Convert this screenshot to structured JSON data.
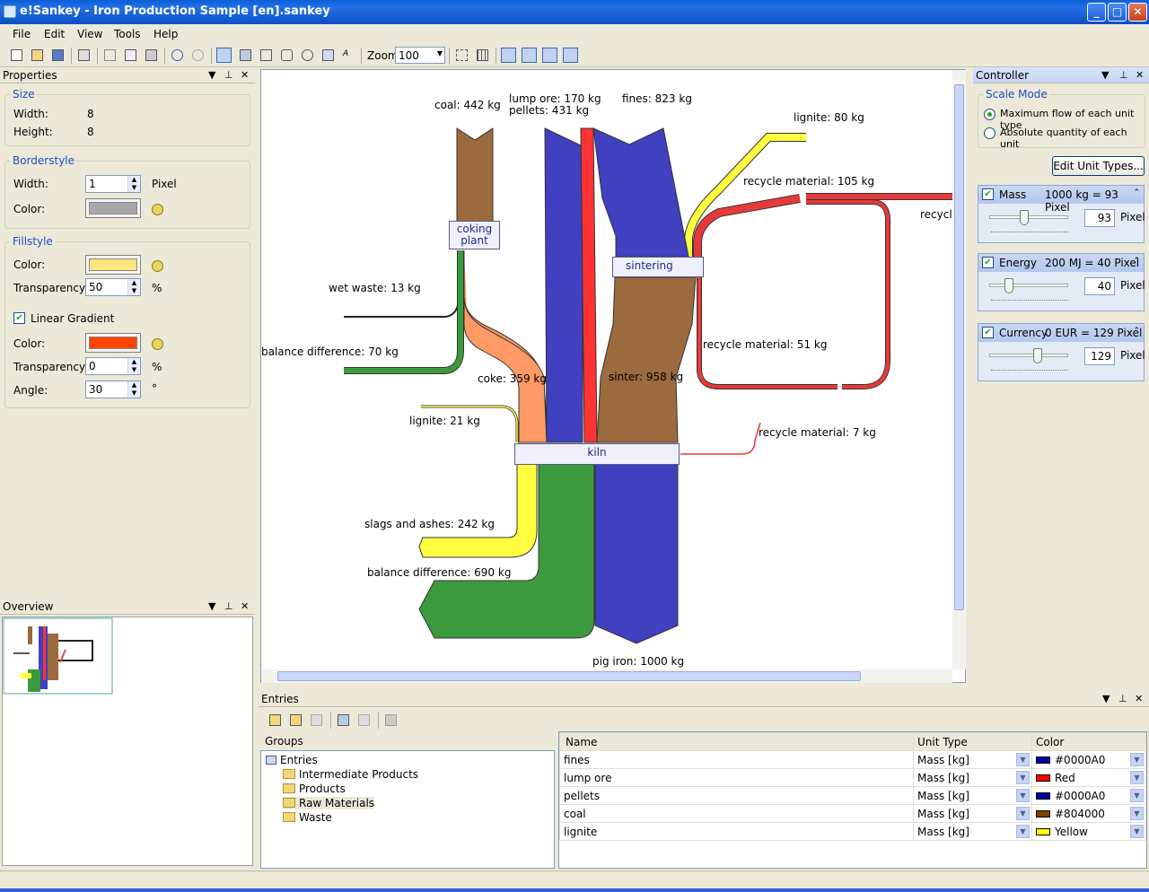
{
  "window": {
    "title": "e!Sankey - Iron Production Sample [en].sankey",
    "min": "_",
    "max": "□",
    "close": "✕"
  },
  "menu": [
    "File",
    "Edit",
    "View",
    "Tools",
    "Help"
  ],
  "toolbar": {
    "zoom_label": "Zoom",
    "zoom_value": "100"
  },
  "properties": {
    "title": "Properties",
    "size": {
      "label": "Size",
      "width_label": "Width:",
      "width": "8",
      "height_label": "Height:",
      "height": "8"
    },
    "borderstyle": {
      "label": "Borderstyle",
      "width_label": "Width:",
      "width": "1",
      "unit": "Pixel",
      "color_label": "Color:",
      "color": "#a8a8a8"
    },
    "fillstyle": {
      "label": "Fillstyle",
      "color_label": "Color:",
      "color": "#ffe680",
      "transparency_label": "Transparency:",
      "transparency": "50",
      "pct": "%",
      "gradient_label": "Linear Gradient",
      "gcolor_label": "Color:",
      "gcolor": "#ff4400",
      "gtrans_label": "Transparency:",
      "gtrans": "0",
      "gpct": "%",
      "angle_label": "Angle:",
      "angle": "30",
      "deg": "°"
    }
  },
  "overview": {
    "title": "Overview"
  },
  "diagram": {
    "labels": {
      "coal": "coal: 442 kg",
      "lump_ore": "lump ore: 170 kg",
      "pellets": "pellets: 431 kg",
      "fines": "fines: 823 kg",
      "lignite80": "lignite: 80 kg",
      "recycle105": "recycle material: 105 kg",
      "recycle_out": "recycle",
      "wet_waste": "wet waste: 13 kg",
      "balance70": "balance difference: 70 kg",
      "coke": "coke: 359 kg",
      "sinter": "sinter: 958 kg",
      "recycle51": "recycle material: 51 kg",
      "lignite21": "lignite: 21 kg",
      "recycle7": "recycle material: 7 kg",
      "slags": "slags and ashes: 242 kg",
      "balance690": "balance difference: 690 kg",
      "pig_iron": "pig iron: 1000 kg"
    },
    "nodes": {
      "coking": "coking\nplant",
      "sintering": "sintering",
      "kiln": "kiln"
    }
  },
  "controller": {
    "title": "Controller",
    "scale_mode": "Scale Mode",
    "opt1": "Maximum flow of each unit type",
    "opt2": "Absolute quantity of each unit",
    "edit_btn": "Edit Unit Types...",
    "units": [
      {
        "name": "Mass",
        "scale": "1000 kg = 93 Pixel",
        "pixel": "93",
        "unit": "Pixel",
        "slider": 0.42
      },
      {
        "name": "Energy",
        "scale": "200 MJ = 40 Pixel",
        "pixel": "40",
        "unit": "Pixel",
        "slider": 0.2
      },
      {
        "name": "Currency",
        "scale": "0 EUR = 129 Pixel",
        "pixel": "129",
        "unit": "Pixel",
        "slider": 0.62
      }
    ]
  },
  "entries": {
    "title": "Entries",
    "groups_label": "Groups",
    "tree": [
      "Entries",
      "Intermediate Products",
      "Products",
      "Raw Materials",
      "Waste"
    ],
    "columns": [
      "Name",
      "Unit Type",
      "Color"
    ],
    "rows": [
      {
        "name": "fines",
        "unit": "Mass [kg]",
        "color_name": "#0000A0",
        "color": "#0000a0"
      },
      {
        "name": "lump ore",
        "unit": "Mass [kg]",
        "color_name": "Red",
        "color": "#ff0000"
      },
      {
        "name": "pellets",
        "unit": "Mass [kg]",
        "color_name": "#0000A0",
        "color": "#0000a0"
      },
      {
        "name": "coal",
        "unit": "Mass [kg]",
        "color_name": "#804000",
        "color": "#804000"
      },
      {
        "name": "lignite",
        "unit": "Mass [kg]",
        "color_name": "Yellow",
        "color": "#ffff00"
      }
    ]
  }
}
